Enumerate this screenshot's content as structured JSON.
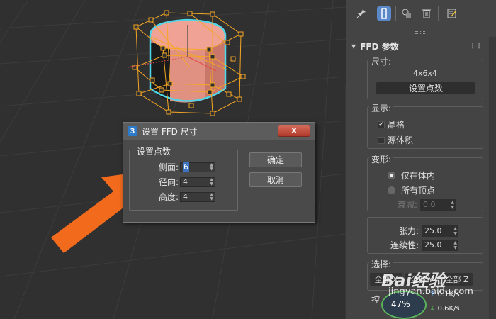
{
  "dialog": {
    "title": "设置 FFD 尺寸",
    "icon_label": "3",
    "close_label": "X",
    "group_label": "设置点数",
    "fields": [
      {
        "label": "侧面:",
        "value": "6"
      },
      {
        "label": "径向:",
        "value": "4"
      },
      {
        "label": "高度:",
        "value": "4"
      }
    ],
    "ok_label": "确定",
    "cancel_label": "取消"
  },
  "panel": {
    "toolbar_icons": [
      "pin-icon",
      "modifier-stack-icon",
      "instance-icon",
      "trash-icon",
      "configure-icon"
    ],
    "rollout_title": "FFD 参数",
    "dimensions": {
      "label": "尺寸:",
      "value": "4x6x4",
      "button": "设置点数"
    },
    "display": {
      "label": "显示:",
      "lattice": {
        "label": "晶格",
        "checked": true
      },
      "source_volume": {
        "label": "源体积",
        "checked": false
      }
    },
    "deform": {
      "label": "变形:",
      "inside_volume": {
        "label": "仅在体内",
        "selected": true
      },
      "all_vertices": {
        "label": "所有顶点",
        "selected": false
      },
      "falloff": {
        "label": "衰减:",
        "value": "0.0"
      }
    },
    "tension": {
      "label": "张力:",
      "value": "25.0"
    },
    "continuity": {
      "label": "连续性:",
      "value": "25.0"
    },
    "selection": {
      "label": "选择:",
      "buttons": [
        "全部 X",
        "全部 Y",
        "全部 Z"
      ]
    },
    "control_label": "控"
  },
  "overlay": {
    "percent": "47%",
    "upload_speed": "0.1K/s",
    "download_speed": "0.6K/s",
    "watermark_text": "Bai经验",
    "watermark_url": "jingyan.baidu.com"
  },
  "colors": {
    "arrow": "#f26b1d",
    "lattice": "#f5a623",
    "selection_outline": "#4fd6e8",
    "cylinder": "#e8968a",
    "panel_bg": "#444444",
    "viewport_bg": "#303030"
  }
}
